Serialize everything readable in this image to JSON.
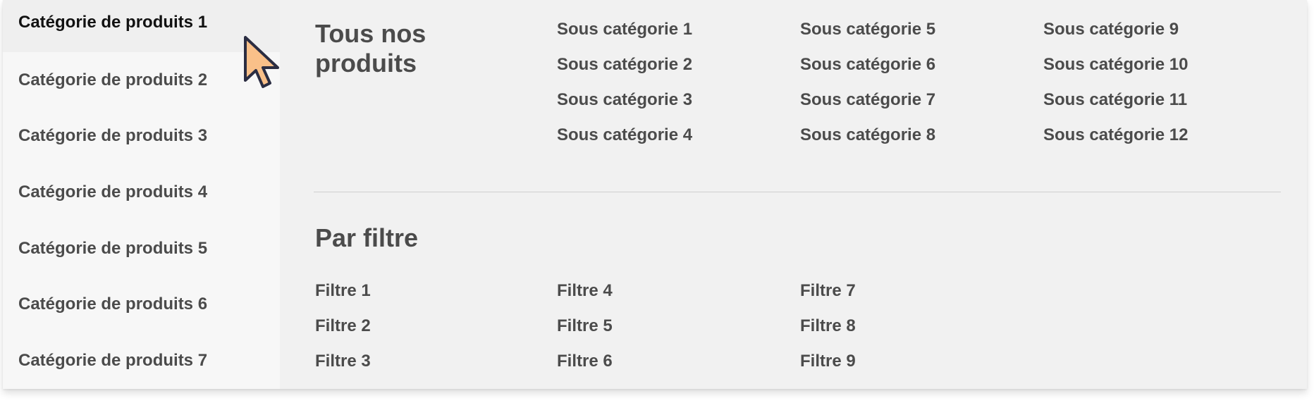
{
  "sidebar": {
    "items": [
      {
        "label": "Catégorie de produits 1"
      },
      {
        "label": "Catégorie de produits 2"
      },
      {
        "label": "Catégorie de produits 3"
      },
      {
        "label": "Catégorie de produits 4"
      },
      {
        "label": "Catégorie de produits 5"
      },
      {
        "label": "Catégorie de produits 6"
      },
      {
        "label": "Catégorie de produits 7"
      }
    ],
    "active_index": 0
  },
  "all_products": {
    "title": "Tous nos produits",
    "subcategories": [
      "Sous catégorie 1",
      "Sous catégorie 2",
      "Sous catégorie 3",
      "Sous catégorie 4",
      "Sous catégorie 5",
      "Sous catégorie 6",
      "Sous catégorie 7",
      "Sous catégorie 8",
      "Sous catégorie 9",
      "Sous catégorie 10",
      "Sous catégorie 11",
      "Sous catégorie 12"
    ]
  },
  "by_filter": {
    "title": "Par filtre",
    "filters": [
      "Filtre 1",
      "Filtre 2",
      "Filtre 3",
      "Filtre 4",
      "Filtre 5",
      "Filtre 6",
      "Filtre 7",
      "Filtre 8",
      "Filtre 9"
    ]
  },
  "cursor": {
    "icon": "mouse-pointer-icon",
    "fill_color": "#f9c089",
    "stroke_color": "#2b2d42"
  },
  "colors": {
    "panel_bg": "#f1f1f1",
    "sidebar_bg": "#f7f7f7",
    "text": "#4b4b4b",
    "active_text": "#111111"
  }
}
